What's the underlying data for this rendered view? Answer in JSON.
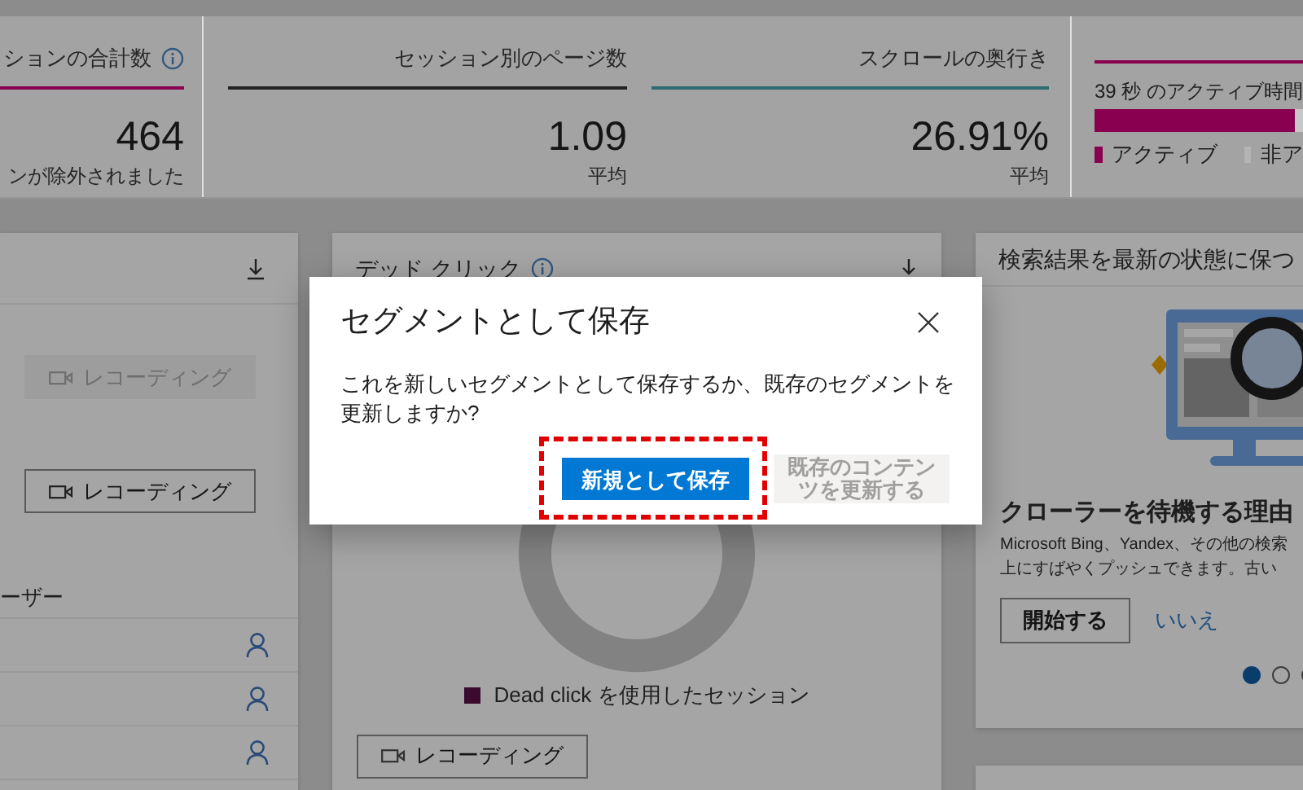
{
  "metrics": [
    {
      "kind": "count",
      "label": "ションの合計数",
      "info": true,
      "color": "#8a0050",
      "value": "464",
      "note": "ンが除外されました"
    },
    {
      "kind": "count",
      "label": "セッション別のページ数",
      "info": false,
      "color": "#222222",
      "value": "1.09",
      "note": "平均"
    },
    {
      "kind": "count",
      "label": "スクロールの奥行き",
      "info": false,
      "color": "#2e6b6e",
      "value": "26.91%",
      "note": "平均"
    },
    {
      "kind": "bar",
      "label": "39 秒 のアクティブ時間",
      "color": "#8a0050",
      "level": 0.92,
      "legend": [
        {
          "label": "アクティブ",
          "color": "#8a0050"
        },
        {
          "label": "非ア",
          "color": "#b4b4b4"
        }
      ]
    }
  ],
  "left_card": {
    "recording_buttons": [
      {
        "label": "レコーディング",
        "disabled": true
      },
      {
        "label": "レコーディング",
        "disabled": false
      }
    ],
    "list_header": "ーザー",
    "rows": [
      {
        "kind": "user"
      },
      {
        "kind": "user"
      },
      {
        "kind": "user"
      }
    ]
  },
  "middle_card": {
    "title": "デッド クリック",
    "info": true,
    "legend": {
      "label": "Dead click を使用したセッション",
      "color": "#3a0a2f"
    },
    "button": "レコーディング"
  },
  "right_card": {
    "title": "検索結果を最新の状態に保つ",
    "heading": "クローラーを待機する理由",
    "description": [
      "Microsoft Bing、Yandex、その他の検索",
      "上にすばやくプッシュできます。古い"
    ],
    "primary": "開始する",
    "link": "いいえ",
    "dots": [
      {
        "selected": true
      },
      {
        "selected": false
      },
      {
        "selected": false
      }
    ]
  },
  "dialog": {
    "title": "セグメントとして保存",
    "message": "これを新しいセグメントとして保存するか、既存のセグメントを更新しますか?",
    "buttons": [
      {
        "label": "新規として保存",
        "kind": "primary",
        "disabled": false,
        "highlighted": true
      },
      {
        "label": "既存のコンテンツを更新する",
        "kind": "secondary",
        "disabled": true,
        "highlighted": false
      }
    ]
  }
}
